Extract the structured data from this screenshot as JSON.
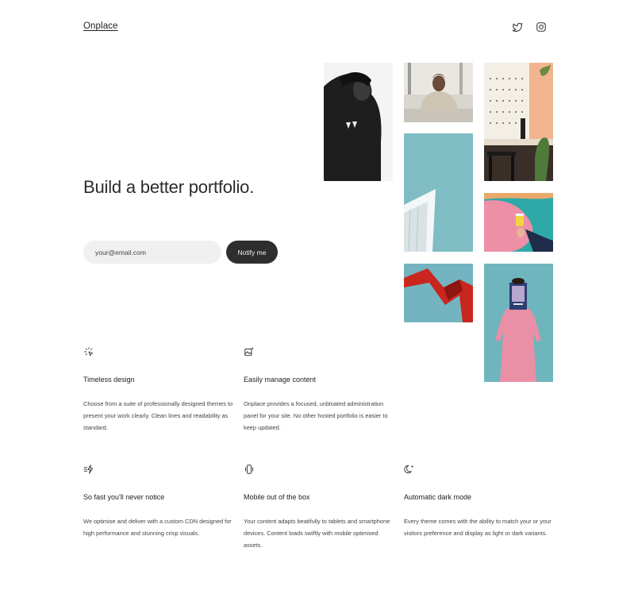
{
  "header": {
    "logo": "Onplace",
    "social": [
      {
        "icon": "twitter-icon"
      },
      {
        "icon": "instagram-icon"
      }
    ]
  },
  "hero": {
    "title": "Build a better portfolio.",
    "email_placeholder": "your@email.com",
    "notify_label": "Notify me"
  },
  "gallery": [
    {
      "subject": "black-and-white portrait of person in black sweater"
    },
    {
      "subject": "man in beige sweater at desk"
    },
    {
      "subject": "cafe interior with peach wall and pegboard"
    },
    {
      "subject": "white building against teal sky"
    },
    {
      "subject": "hand holding yellow cup against pink wall"
    },
    {
      "subject": "red abstract sculpture against teal sky"
    },
    {
      "subject": "woman in pink dress holding magazine over face"
    }
  ],
  "features": [
    {
      "icon": "cursor-click-icon",
      "title": "Timeless design",
      "description": "Choose from a suite of professionally designed themes to present your work clearly. Clean lines and readability as standard."
    },
    {
      "icon": "image-sparkle-icon",
      "title": "Easily manage content",
      "description": "Onplace provides a focused, unbloated administration panel for your site. No other hosted portfolio is easier to keep updated."
    },
    {
      "icon": "fast-lightning-icon",
      "title": "So fast you'll never notice",
      "description": "We optimise and deliver with a custom CDN designed for high performance and stunning crisp visuals."
    },
    {
      "icon": "phone-vibrate-icon",
      "title": "Mobile out of the box",
      "description": "Your content adapts beatifully to tablets and smartphone devices. Content loads swiftly with mobile optimised assets."
    },
    {
      "icon": "moon-sparkle-icon",
      "title": "Automatic dark mode",
      "description": "Every theme comes with the ability to match your or your visitors preference and display as light or dark variants."
    }
  ],
  "colors": {
    "button_bg": "#2e2e2e",
    "input_bg": "#f0f0f0",
    "teal": "#6fb5bd",
    "pink": "#e98fa6"
  }
}
